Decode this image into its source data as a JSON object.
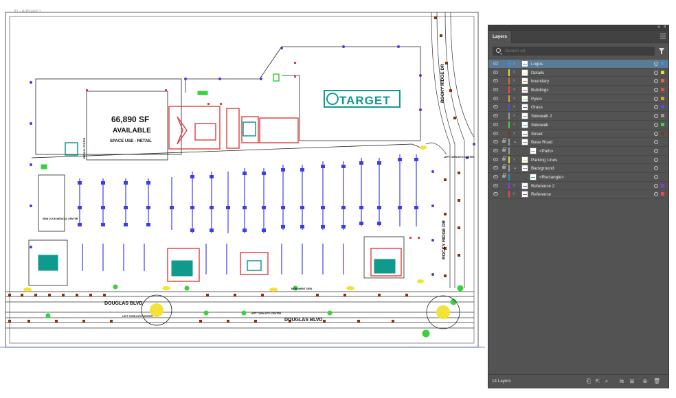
{
  "canvas": {
    "artboard_label": "01 - Artboard 1",
    "map_labels": {
      "space_big": "66,890 SF",
      "space_available": "AVAILABLE",
      "space_use": "SPACE USE - RETAIL",
      "target": "TARGET",
      "rocky_ridge_top": "ROCKY RIDGE DR",
      "rocky_ridge_bottom": "ROCKY RIDGE DR",
      "douglas_left": "DOUGLAS BLVD",
      "douglas_right": "DOUGLAS BLVD",
      "left_turn_1": "LEFT TURN INTO CENTER",
      "left_turn_2": "LEFT TURN INTO CENTER",
      "left_turn_3": "LEFT TURN INTO CENTER",
      "medical_1": "MEDICAL CENTER",
      "medical_2": "NEW LOOK MEDICAL CENTER",
      "monument": "MONUMENT SIGN"
    },
    "colors": {
      "parking": "#3d3df0",
      "building_outline": "#1a1a1a",
      "red": "#e23b3b",
      "teal": "#0f9a8e",
      "green": "#36d23a",
      "brown": "#8b2d0e",
      "yellow": "#f2e23a"
    }
  },
  "panel": {
    "title": "Layers",
    "search_placeholder": "Search All",
    "layer_count": "14 Layers",
    "layers": [
      {
        "name": "Logos",
        "color": "#3a8fd8",
        "expanded": false,
        "indent": 0,
        "locked": false,
        "selected": true
      },
      {
        "name": "Details",
        "color": "#e8d83a",
        "expanded": false,
        "indent": 0,
        "locked": false,
        "selected": false
      },
      {
        "name": "boundary",
        "color": "#e06a2a",
        "expanded": false,
        "indent": 0,
        "locked": false,
        "selected": false
      },
      {
        "name": "Buildings",
        "color": "#e84a4a",
        "expanded": false,
        "indent": 0,
        "locked": false,
        "selected": false
      },
      {
        "name": "Pylon",
        "color": "#e0a02a",
        "expanded": false,
        "indent": 0,
        "locked": false,
        "selected": false
      },
      {
        "name": "Grass",
        "color": "#5a4ad8",
        "expanded": false,
        "indent": 0,
        "locked": false,
        "selected": false
      },
      {
        "name": "Sidewalk 2",
        "color": "#9a9a9a",
        "expanded": false,
        "indent": 0,
        "locked": false,
        "selected": false
      },
      {
        "name": "Sidewalk",
        "color": "#3ad84a",
        "expanded": false,
        "indent": 0,
        "locked": false,
        "selected": false
      },
      {
        "name": "Street",
        "color": "#7a3a1a",
        "expanded": false,
        "indent": 0,
        "locked": false,
        "selected": false
      },
      {
        "name": "Base Road",
        "color": "#9a9a9a",
        "expanded": true,
        "indent": 0,
        "locked": true,
        "selected": false
      },
      {
        "name": "<Path>",
        "color": "#9a9a9a",
        "expanded": false,
        "indent": 1,
        "locked": true,
        "selected": false
      },
      {
        "name": "Parking Lines",
        "color": "#e8d83a",
        "expanded": false,
        "indent": 0,
        "locked": true,
        "selected": false
      },
      {
        "name": "Background",
        "color": "#9a9a9a",
        "expanded": true,
        "indent": 0,
        "locked": true,
        "selected": false
      },
      {
        "name": "<Rectangle>",
        "color": "#2a9a9a",
        "expanded": false,
        "indent": 1,
        "locked": true,
        "selected": false
      },
      {
        "name": "Reference 2",
        "color": "#8a3ad8",
        "expanded": false,
        "indent": 0,
        "locked": false,
        "selected": false
      },
      {
        "name": "Reference",
        "color": "#e84a4a",
        "expanded": false,
        "indent": 0,
        "locked": false,
        "selected": false
      }
    ],
    "footer_icons": [
      "collect-for-export-icon",
      "locate-object-icon",
      "make-clipping-mask-icon",
      "new-sublayer-icon",
      "new-layer-icon",
      "delete-icon"
    ]
  }
}
